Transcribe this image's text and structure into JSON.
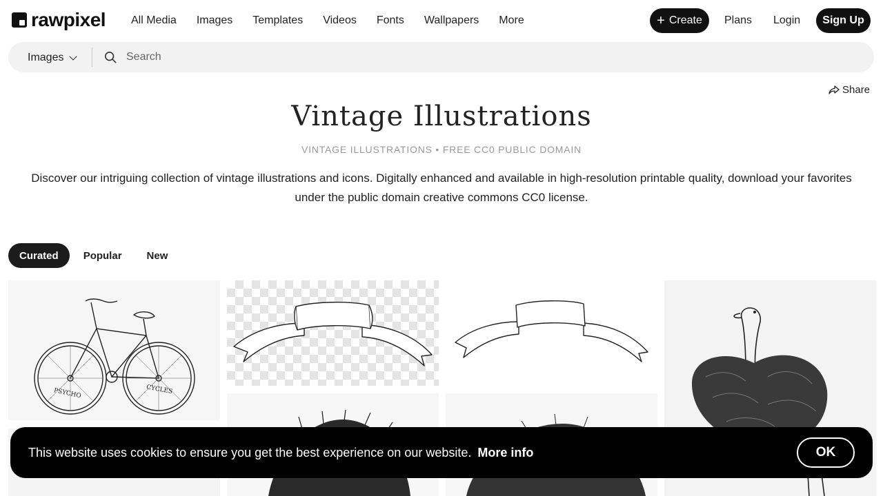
{
  "header": {
    "logo_text": "rawpixel",
    "nav": [
      "All Media",
      "Images",
      "Templates",
      "Videos",
      "Fonts",
      "Wallpapers",
      "More"
    ],
    "create_label": "Create",
    "plans_label": "Plans",
    "login_label": "Login",
    "signup_label": "Sign Up"
  },
  "search": {
    "category": "Images",
    "placeholder": "Search"
  },
  "share_label": "Share",
  "page": {
    "title": "Vintage Illustrations",
    "subtitle": "VINTAGE ILLUSTRATIONS • FREE CC0 PUBLIC DOMAIN",
    "description": "Discover our intriguing collection of vintage illustrations and icons. Digitally enhanced and available in high-resolution printable quality, download your favorites under the public domain creative commons CC0 license."
  },
  "tabs": [
    "Curated",
    "Popular",
    "New"
  ],
  "tiles": {
    "bicycle_labels": [
      "PSYCHO",
      "CYCLES"
    ]
  },
  "cookie": {
    "text": "This website uses cookies to ensure you get the best experience on our website.",
    "more_info": "More info",
    "ok_label": "OK"
  },
  "colors": {
    "primary": "#111111",
    "search_bg": "#f2f2f2",
    "subtitle": "#9a9a9a"
  }
}
